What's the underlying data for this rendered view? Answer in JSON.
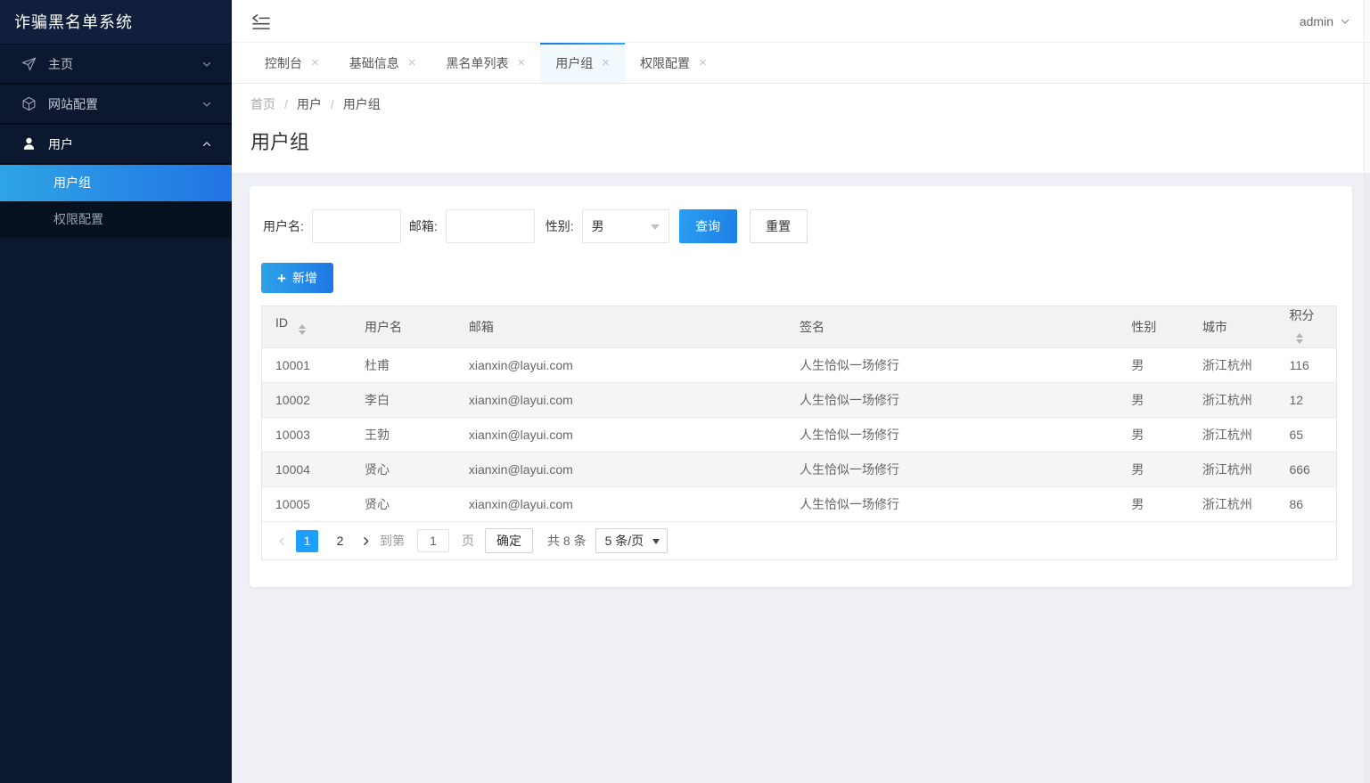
{
  "app": {
    "title": "诈骗黑名单系统"
  },
  "header": {
    "username": "admin"
  },
  "colors": {
    "accent": "#1E9FFF",
    "sidebar_bg": "#0C1A30",
    "active_menu_gradient_start": "#2EA5E4",
    "active_menu_gradient_end": "#2273E4",
    "tab_active_bg": "#F1F8FE",
    "table_header_bg": "#F2F2F2",
    "stripe_bg": "#F5F5F5"
  },
  "sidebar": {
    "items": [
      {
        "label": "主页",
        "icon": "send-icon",
        "state": "collapsed"
      },
      {
        "label": "网站配置",
        "icon": "cube-icon",
        "state": "collapsed"
      },
      {
        "label": "用户",
        "icon": "user-icon",
        "state": "expanded",
        "children": [
          {
            "label": "用户组",
            "active": true
          },
          {
            "label": "权限配置",
            "active": false
          }
        ]
      }
    ]
  },
  "tabs": [
    {
      "label": "控制台",
      "active": false
    },
    {
      "label": "基础信息",
      "active": false
    },
    {
      "label": "黑名单列表",
      "active": false
    },
    {
      "label": "用户组",
      "active": true
    },
    {
      "label": "权限配置",
      "active": false
    }
  ],
  "breadcrumb": {
    "separator": "/",
    "items": [
      "首页",
      "用户",
      "用户组"
    ]
  },
  "page": {
    "title": "用户组"
  },
  "filters": {
    "username": {
      "label": "用户名:",
      "value": "",
      "placeholder": ""
    },
    "email": {
      "label": "邮箱:",
      "value": "",
      "placeholder": ""
    },
    "gender": {
      "label": "性别:",
      "value": "男"
    },
    "search_button": "查询",
    "reset_button": "重置"
  },
  "toolbar": {
    "add_button": "新增"
  },
  "table": {
    "columns": [
      {
        "label": "ID",
        "sortable": true
      },
      {
        "label": "用户名",
        "sortable": false
      },
      {
        "label": "邮箱",
        "sortable": false
      },
      {
        "label": "签名",
        "sortable": false
      },
      {
        "label": "性别",
        "sortable": false
      },
      {
        "label": "城市",
        "sortable": false
      },
      {
        "label": "积分",
        "sortable": true
      }
    ],
    "rows": [
      [
        "10001",
        "杜甫",
        "xianxin@layui.com",
        "人生恰似一场修行",
        "男",
        "浙江杭州",
        "116"
      ],
      [
        "10002",
        "李白",
        "xianxin@layui.com",
        "人生恰似一场修行",
        "男",
        "浙江杭州",
        "12"
      ],
      [
        "10003",
        "王勃",
        "xianxin@layui.com",
        "人生恰似一场修行",
        "男",
        "浙江杭州",
        "65"
      ],
      [
        "10004",
        "贤心",
        "xianxin@layui.com",
        "人生恰似一场修行",
        "男",
        "浙江杭州",
        "666"
      ],
      [
        "10005",
        "贤心",
        "xianxin@layui.com",
        "人生恰似一场修行",
        "男",
        "浙江杭州",
        "86"
      ]
    ]
  },
  "pagination": {
    "pages": [
      "1",
      "2"
    ],
    "current": "1",
    "page_two": "2",
    "goto_label": "到第",
    "goto_value": "1",
    "page_suffix": "页",
    "confirm_button": "确定",
    "total_label": "共 8 条",
    "page_size": "5 条/页"
  }
}
